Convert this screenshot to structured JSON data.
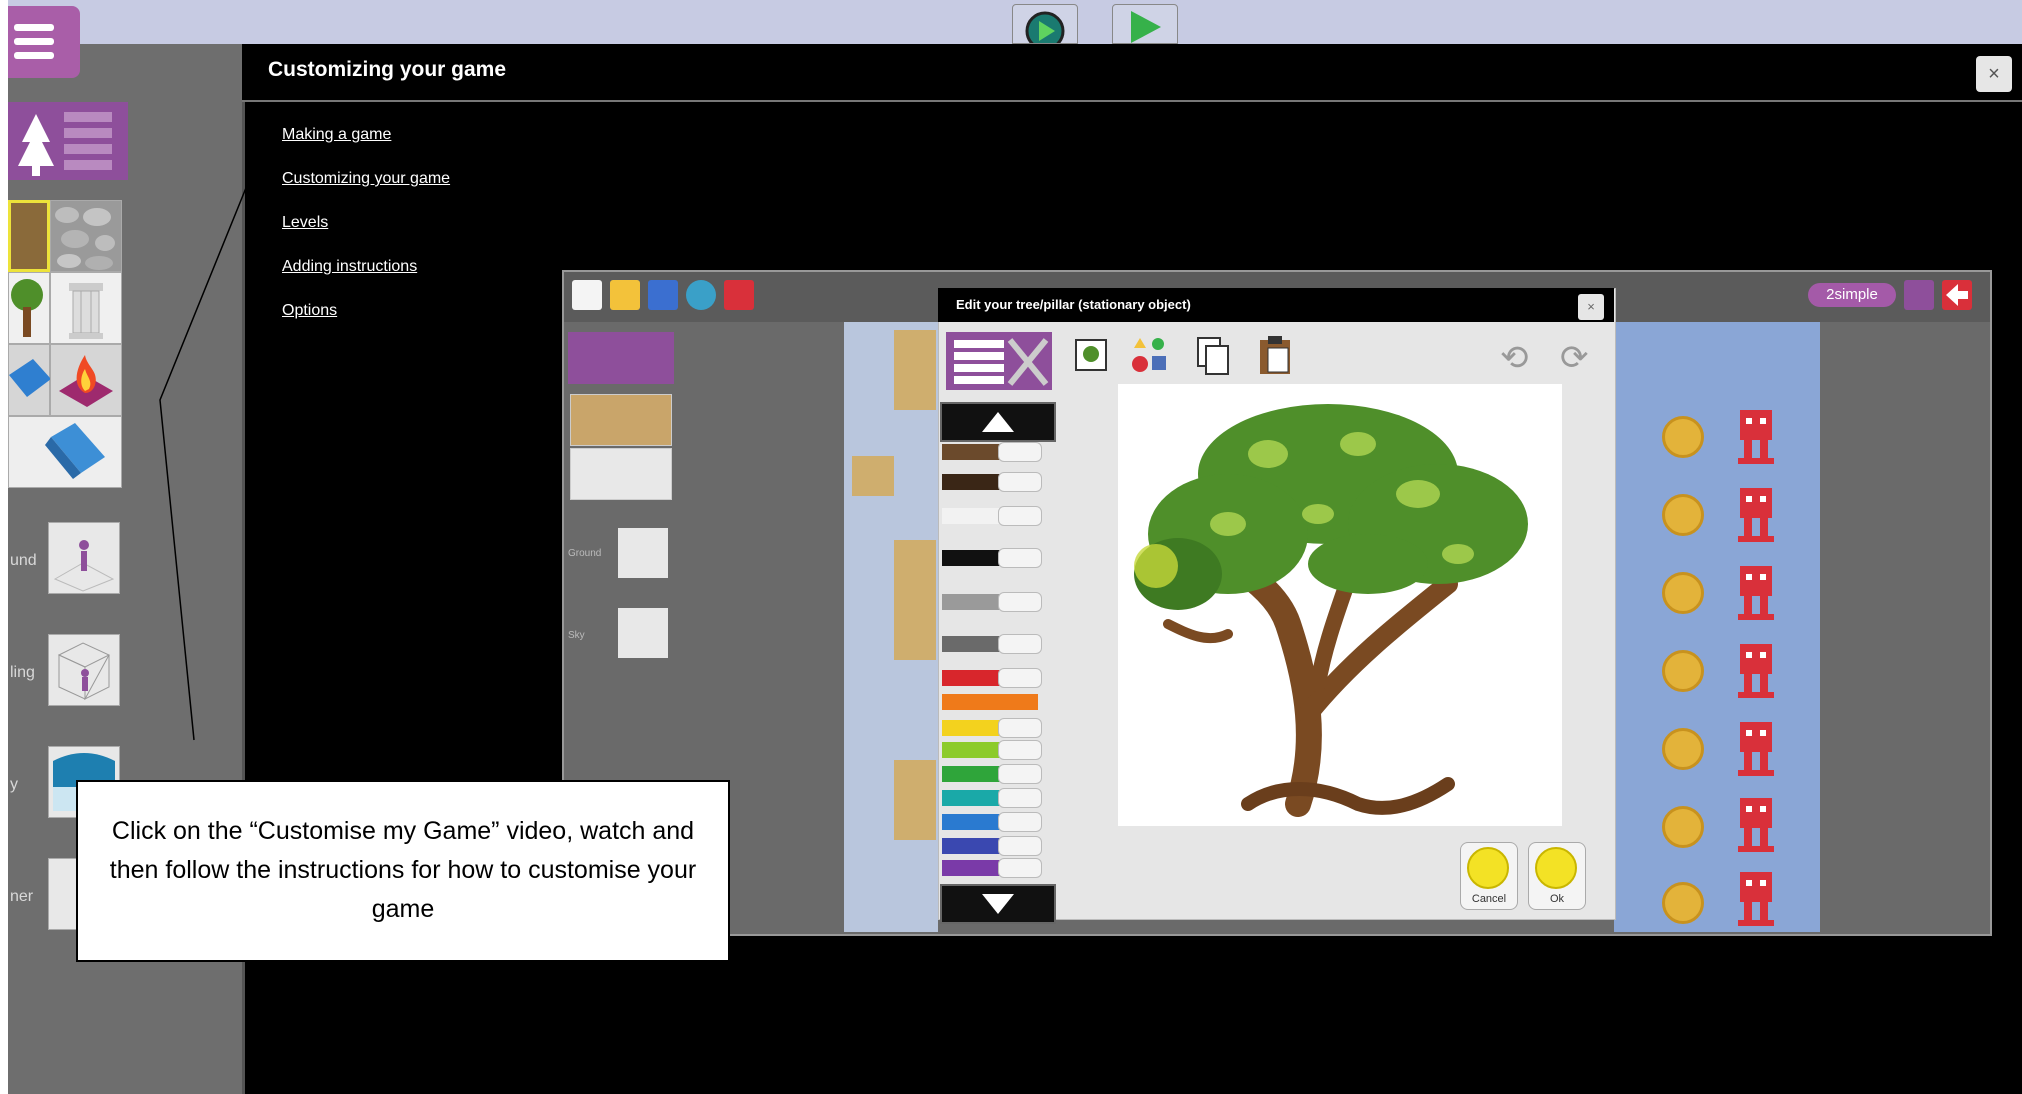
{
  "help": {
    "title": "Customizing your game",
    "close": "×",
    "links": [
      "Making a game",
      "Customizing your game",
      "Levels",
      "Adding instructions",
      "Options"
    ]
  },
  "sidebar": {
    "labels": [
      "und",
      "ling",
      "y",
      "ner"
    ]
  },
  "video": {
    "side_labels": [
      "Ground",
      "Sky"
    ],
    "brand": "2simple",
    "dialog": {
      "title": "Edit your tree/pillar (stationary object)",
      "close": "×",
      "cancel": "Cancel",
      "ok": "Ok"
    }
  },
  "callout": {
    "text": "Click on the “Customise my Game” video, watch and then follow the instructions for how to customise your game"
  },
  "colors": {
    "menu_purple": "#a95ea8",
    "tile_purple": "#8e4f9b",
    "background_gray": "#6e6e6e",
    "top_bar": "#c7cbe3",
    "help_bg": "#000000",
    "level_blue": "#8aa6d6",
    "coin_gold": "#e3b33a",
    "robot_red": "#d9303a",
    "tree_green": "#4f8f2a",
    "tree_brown": "#7a4a22"
  }
}
